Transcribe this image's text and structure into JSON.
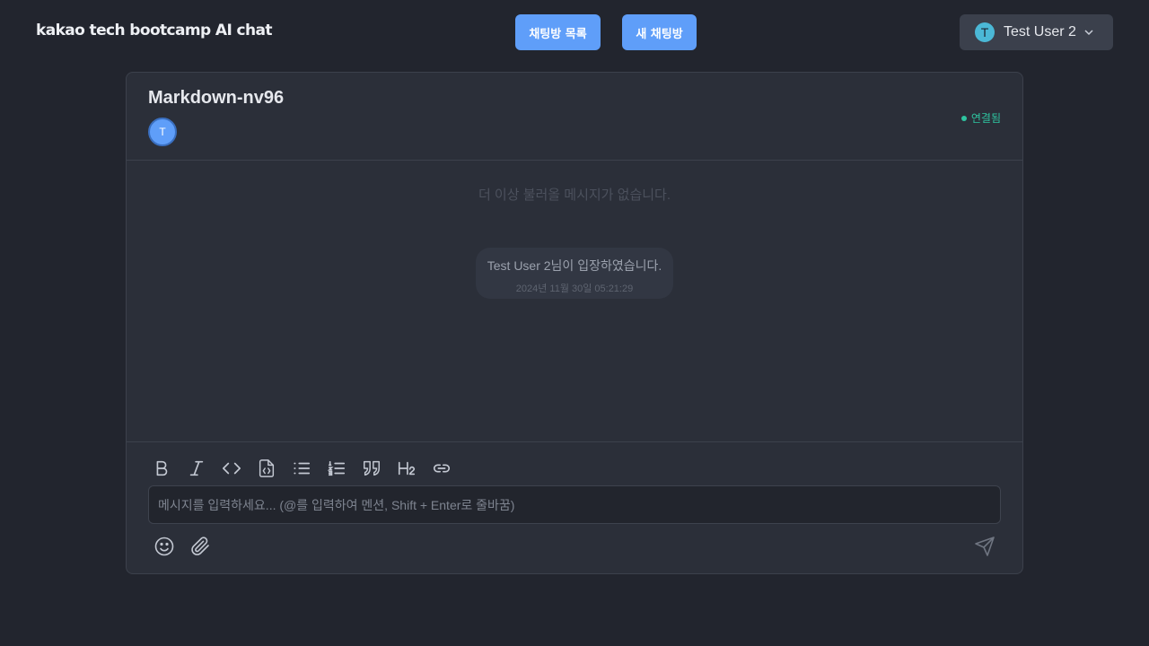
{
  "header": {
    "logo": "kakao tech bootcamp AI chat",
    "chat_list_button": "채팅방 목록",
    "new_chat_button": "새 채팅방",
    "user": {
      "initial": "T",
      "name": "Test User 2"
    }
  },
  "room": {
    "title": "Markdown-nv96",
    "participant_initial": "T",
    "connection_status": "연결됨"
  },
  "messages": {
    "no_more_text": "더 이상 불러올 메시지가 없습니다.",
    "system": {
      "text": "Test User 2님이 입장하였습니다.",
      "time": "2024년 11월 30일 05:21:29"
    }
  },
  "composer": {
    "placeholder": "메시지를 입력하세요... (@를 입력하여 멘션, Shift + Enter로 줄바꿈)",
    "value": "",
    "toolbar": [
      "bold-icon",
      "italic-icon",
      "code-icon",
      "code-block-icon",
      "bullet-list-icon",
      "numbered-list-icon",
      "quote-icon",
      "heading-icon",
      "link-icon"
    ],
    "actions": [
      "emoji-icon",
      "paperclip-icon",
      "send-icon"
    ]
  },
  "colors": {
    "background": "#22252e",
    "card": "#2b2f39",
    "accent": "#5f9ef9",
    "connected": "#2ec4a0"
  }
}
